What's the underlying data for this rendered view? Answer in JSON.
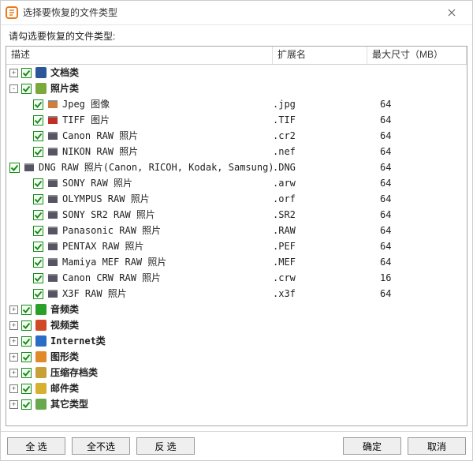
{
  "title": "选择要恢复的文件类型",
  "prompt": "请勾选要恢复的文件类型:",
  "columns": {
    "desc": "描述",
    "ext": "扩展名",
    "max": "最大尺寸（MB）"
  },
  "buttons": {
    "all": "全 选",
    "none": "全不选",
    "invert": "反 选",
    "ok": "确定",
    "cancel": "取消"
  },
  "tree": [
    {
      "exp": "+",
      "label": "文档类",
      "iconColor": "#2b579a"
    },
    {
      "exp": "-",
      "label": "照片类",
      "iconColor": "#7aa93c",
      "children": [
        {
          "label": "Jpeg 图像",
          "ext": ".jpg",
          "max": "64",
          "ic": "#d07c3a"
        },
        {
          "label": "TIFF 图片",
          "ext": ".TIF",
          "max": "64",
          "ic": "#c03028"
        },
        {
          "label": "Canon RAW 照片",
          "ext": ".cr2",
          "max": "64",
          "ic": "#556"
        },
        {
          "label": "NIKON RAW 照片",
          "ext": ".nef",
          "max": "64",
          "ic": "#556"
        },
        {
          "label": "DNG RAW 照片(Canon, RICOH, Kodak, Samsung)",
          "ext": ".DNG",
          "max": "64",
          "ic": "#556"
        },
        {
          "label": "SONY RAW 照片",
          "ext": ".arw",
          "max": "64",
          "ic": "#556"
        },
        {
          "label": "OLYMPUS RAW 照片",
          "ext": ".orf",
          "max": "64",
          "ic": "#556"
        },
        {
          "label": "SONY SR2 RAW 照片",
          "ext": ".SR2",
          "max": "64",
          "ic": "#556"
        },
        {
          "label": "Panasonic RAW 照片",
          "ext": ".RAW",
          "max": "64",
          "ic": "#556"
        },
        {
          "label": "PENTAX RAW 照片",
          "ext": ".PEF",
          "max": "64",
          "ic": "#556"
        },
        {
          "label": "Mamiya MEF RAW 照片",
          "ext": ".MEF",
          "max": "64",
          "ic": "#556"
        },
        {
          "label": "Canon CRW RAW 照片",
          "ext": ".crw",
          "max": "16",
          "ic": "#556"
        },
        {
          "label": "X3F RAW 照片",
          "ext": ".x3f",
          "max": "64",
          "ic": "#556"
        }
      ]
    },
    {
      "exp": "+",
      "label": "音频类",
      "iconColor": "#2aa02a"
    },
    {
      "exp": "+",
      "label": "视频类",
      "iconColor": "#d04828"
    },
    {
      "exp": "+",
      "label": "Internet类",
      "iconColor": "#2b6cc4"
    },
    {
      "exp": "+",
      "label": "图形类",
      "iconColor": "#e08a2a"
    },
    {
      "exp": "+",
      "label": "压缩存档类",
      "iconColor": "#c8a038"
    },
    {
      "exp": "+",
      "label": "邮件类",
      "iconColor": "#d8b030"
    },
    {
      "exp": "+",
      "label": "其它类型",
      "iconColor": "#6aa84f"
    }
  ]
}
